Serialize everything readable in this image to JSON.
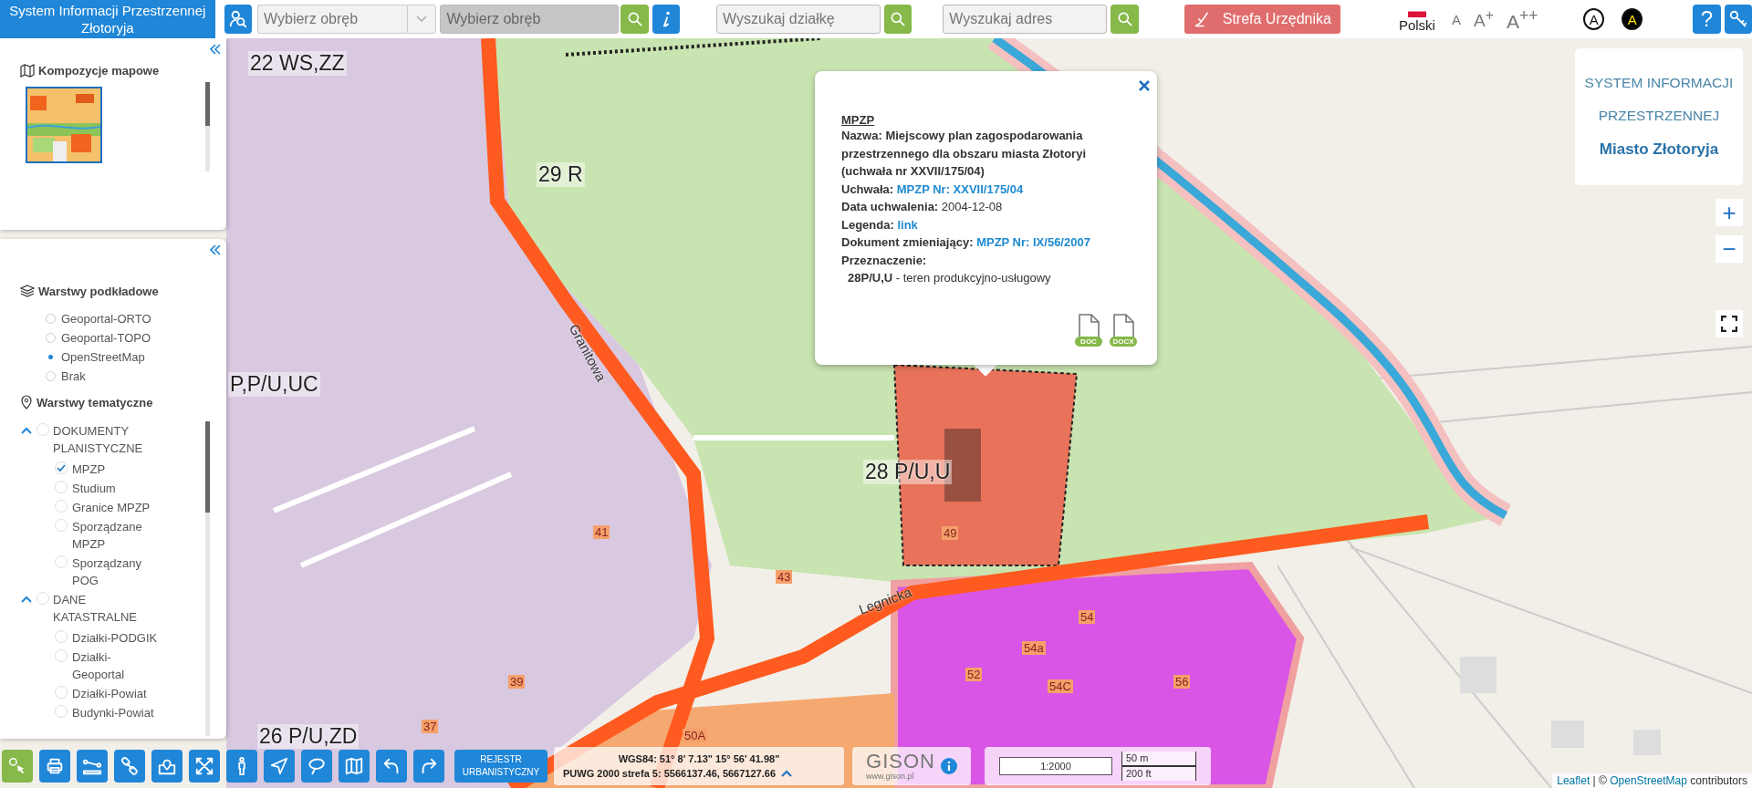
{
  "header": {
    "title": "System Informacji Przestrzennej Złotoryja",
    "precinct_select": {
      "placeholder": "Wybierz obręb"
    },
    "precinct_field": {
      "placeholder": "Wybierz obręb",
      "disabled": true
    },
    "parcel_search": {
      "placeholder": "Wyszukaj działkę"
    },
    "address_search": {
      "placeholder": "Wyszukaj adres"
    },
    "official_zone_button": "Strefa Urzędnika",
    "language": "Polski",
    "font_sizes": [
      "A",
      "A$^{+}$",
      "A$^{++}$"
    ],
    "contrast_options": [
      {
        "label": "A",
        "kind": "normal"
      },
      {
        "label": "A",
        "kind": "high"
      }
    ],
    "help_button": "?"
  },
  "sidebar": {
    "compositions": {
      "title": "Kompozycje mapowe"
    },
    "base_layers": {
      "title": "Warstwy podkładowe",
      "items": [
        {
          "label": "Geoportal-ORTO",
          "selected": false
        },
        {
          "label": "Geoportal-TOPO",
          "selected": false
        },
        {
          "label": "OpenStreetMap",
          "selected": true
        },
        {
          "label": "Brak",
          "selected": false
        }
      ]
    },
    "thematic_layers": {
      "title": "Warstwy tematyczne",
      "groups": [
        {
          "label": "DOKUMENTY PLANISTYCZNE",
          "expanded": true,
          "checked": false,
          "children": [
            {
              "label": "MPZP",
              "checked": true
            },
            {
              "label": "Studium",
              "checked": false
            },
            {
              "label": "Granice MPZP",
              "checked": false
            },
            {
              "label": "Sporządzane MPZP",
              "checked": false
            },
            {
              "label": "Sporządzany POG",
              "checked": false
            }
          ]
        },
        {
          "label": "DANE KATASTRALNE",
          "expanded": true,
          "checked": false,
          "children": [
            {
              "label": "Działki-PODGIK",
              "checked": false
            },
            {
              "label": "Działki-Geoportal",
              "checked": false
            },
            {
              "label": "Działki-Powiat",
              "checked": false
            },
            {
              "label": "Budynki-Powiat",
              "checked": false
            }
          ]
        }
      ]
    }
  },
  "popup": {
    "heading": "MPZP",
    "lines": [
      {
        "kind": "bold",
        "text": "Nazwa: Miejscowy plan zagospodarowania przestrzennego dla obszaru miasta Złotoryi (uchwała nr XXVII/175/04)"
      },
      {
        "kind": "link",
        "label": "Uchwała:",
        "value": "MPZP Nr: XXVII/175/04"
      },
      {
        "kind": "value",
        "label": "Data uchwalenia:",
        "value": "2004-12-08"
      },
      {
        "kind": "link",
        "label": "Legenda:",
        "value": "link"
      },
      {
        "kind": "link",
        "label": "Dokument zmieniający:",
        "value": "MPZP Nr: IX/56/2007"
      },
      {
        "kind": "bold",
        "text": "Przeznaczenie:"
      },
      {
        "kind": "purpose",
        "label": "28P/U,U",
        "value": "- teren produkcyjno-usługowy"
      }
    ],
    "downloads": [
      "DOC",
      "DOCX"
    ]
  },
  "brand_panel": {
    "lines": [
      "SYSTEM INFORMACJI",
      "PRZESTRZENNEJ"
    ],
    "city": "Miasto Złotoryja"
  },
  "zoom": {
    "zoom_in": "+",
    "zoom_out": "−"
  },
  "map": {
    "labels": [
      {
        "kind": "zone",
        "text": "22 WS,ZZ"
      },
      {
        "kind": "zone",
        "text": "29 R"
      },
      {
        "kind": "zone",
        "text": "P,P/U,UC"
      },
      {
        "kind": "street",
        "text": "Granitowa"
      },
      {
        "kind": "zone",
        "text": "28 P/U,U"
      },
      {
        "kind": "street",
        "text": "Legnicka"
      },
      {
        "kind": "zone",
        "text": "26 P/U,ZD"
      },
      {
        "kind": "parcel",
        "text": "41"
      },
      {
        "kind": "parcel",
        "text": "43"
      },
      {
        "kind": "parcel",
        "text": "49"
      },
      {
        "kind": "parcel",
        "text": "39"
      },
      {
        "kind": "parcel",
        "text": "37"
      },
      {
        "kind": "parcel",
        "text": "54a"
      },
      {
        "kind": "parcel",
        "text": "54"
      },
      {
        "kind": "parcel",
        "text": "52"
      },
      {
        "kind": "parcel",
        "text": "54C"
      },
      {
        "kind": "parcel",
        "text": "56"
      },
      {
        "kind": "parcel",
        "text": "50A"
      }
    ],
    "attribution": {
      "library": "Leaflet",
      "separator": "| ©",
      "source": "OpenStreetMap",
      "suffix": "contributors"
    }
  },
  "bottom_bar": {
    "tools": [
      {
        "kind": "select",
        "selected": true
      },
      {
        "kind": "print",
        "selected": false
      },
      {
        "kind": "measure",
        "selected": false
      },
      {
        "kind": "link",
        "selected": false
      },
      {
        "kind": "pin",
        "selected": false
      },
      {
        "kind": "extent",
        "selected": false
      },
      {
        "kind": "person",
        "selected": false
      },
      {
        "kind": "locate",
        "selected": false
      },
      {
        "kind": "lasso",
        "selected": false
      },
      {
        "kind": "map",
        "selected": false
      },
      {
        "kind": "undo",
        "selected": false
      },
      {
        "kind": "redo",
        "selected": false
      }
    ],
    "register_button": "REJESTR URBANISTYCZNY",
    "coordinates": {
      "wgs84": "WGS84: 51° 8' 7.13\" 15° 56' 41.98\"",
      "puwg": "PUWG 2000 strefa 5: 5566137.46, 5667127.66"
    },
    "brand": {
      "name": "GISON",
      "url": "www.gison.pl"
    },
    "scale": "1:2000",
    "scale_bar": [
      "50 m",
      "200 ft"
    ]
  }
}
